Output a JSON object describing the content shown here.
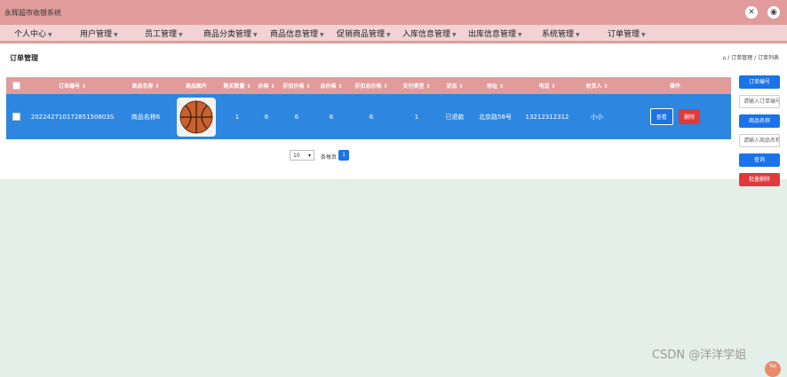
{
  "app": {
    "title": "永辉超市收银系统"
  },
  "header_icons": [
    "expand-icon",
    "user-icon"
  ],
  "nav": {
    "items": [
      {
        "label": "个人中心"
      },
      {
        "label": "用户管理"
      },
      {
        "label": "员工管理"
      },
      {
        "label": "商品分类管理"
      },
      {
        "label": "商品信息管理"
      },
      {
        "label": "促销商品管理"
      },
      {
        "label": "入库信息管理"
      },
      {
        "label": "出库信息管理"
      },
      {
        "label": "系统管理"
      },
      {
        "label": "订单管理"
      }
    ]
  },
  "page": {
    "title": "订单管理",
    "breadcrumb": "/ 订单管理 / 订单列表"
  },
  "table": {
    "headers": [
      "订单编号 ⇕",
      "商品名称 ⇕",
      "商品图片",
      "购买数量 ⇕",
      "价格 ⇕",
      "折扣价格 ⇕",
      "总价格 ⇕",
      "折扣总价格 ⇕",
      "支付类型 ⇕",
      "状态 ⇕",
      "地址 ⇕",
      "电话 ⇕",
      "收货人 ⇕",
      "操作"
    ],
    "rows": [
      {
        "order_no": "20224271017285150603S",
        "product_name": "商品名称6",
        "quantity": "1",
        "price": "6",
        "discount_price": "6",
        "total": "6",
        "discount_total": "6",
        "pay_type": "1",
        "status": "已退款",
        "address": "北京路58号",
        "phone": "13212312312",
        "receiver": "小小",
        "view_label": "查看",
        "delete_label": "删除"
      }
    ]
  },
  "pagination": {
    "page_size": "10",
    "per_page_label": "条每页",
    "current_page": "1"
  },
  "sidebar": {
    "order_no_label": "订单编号",
    "order_no_placeholder": "请输入订单编号",
    "product_name_label": "商品名称",
    "product_name_placeholder": "请输入商品名称",
    "search_label": "查询",
    "batch_delete_label": "批量删除"
  },
  "watermark": "CSDN @洋洋学姐",
  "back_to_top": "Top",
  "colors": {
    "header": "#e29b9b",
    "row_selected": "#2d86e0",
    "primary": "#1a73e8",
    "danger": "#e03a3a"
  }
}
